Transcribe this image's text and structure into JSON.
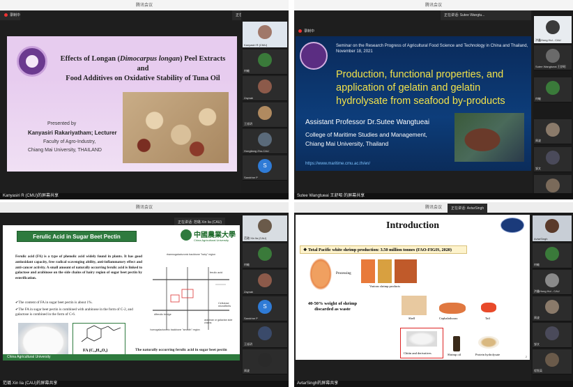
{
  "window_title": "腾讯会议",
  "recording_label": "录制中",
  "q1": {
    "slide": {
      "title": "Effects of Longan (Dimocarpus longan) Peel Extracts and Food Additives on Oxidative Stability of Tuna Oil",
      "title_line1_pre": "Effects of Longan (",
      "title_line1_italic": "Dimocarpus longan",
      "title_line1_post": ") Peel Extracts",
      "title_line2": "and",
      "title_line3": "Food Additives on Oxidative Stability of Tuna Oil",
      "presented_by": "Presented by",
      "presenter": "Kanyasiri  Rakariyatham; Lecturer",
      "affil1": "Faculty of Agro-Industry,",
      "affil2": "Chiang Mai University, THAILAND"
    },
    "speaking": "正在讲话: Kanyasiri R (CMU)",
    "participants": [
      {
        "name": "Kanyasiri R (CMU)"
      },
      {
        "name": "何敏"
      },
      {
        "name": "Zaynab"
      },
      {
        "name": "王娅玥"
      },
      {
        "name": "Hongliang Zhu-CAU"
      },
      {
        "name": "Sandrine P",
        "initial": "S"
      }
    ],
    "footer": "Kanyasiri R (CMU)的屏幕共享"
  },
  "q2": {
    "speaking": "正在讲话: Sutee Wangtu...",
    "slide": {
      "seminar": "Seminar on the Research Progress of Agricultural Food Science and Technology in China and Thailand, November 18, 2021",
      "title": "Production, functional properties, and application of gelatin and gelatin hydrolysate from seafood by-products",
      "presenter": "Assistant Professor Dr.Sutee Wangtueai",
      "affil1": "College of Maritime Studies and Management,",
      "affil2": "Chiang Mai University, Thailand",
      "url": "https://www.maritime.cmu.ac.th/en/"
    },
    "participants": [
      {
        "name": "洪鑫Hong Hui - CAU"
      },
      {
        "name": "Sutee Wangtueai 王舒昭"
      },
      {
        "name": "何敏"
      },
      {
        "name": "周波"
      },
      {
        "name": "邹文"
      },
      {
        "name": "李晓茜"
      }
    ],
    "footer": "Sutee Wangtueai 王舒昭 的屏幕共享"
  },
  "q3": {
    "speaking": "正在讲话: 范璐 Xin lia (CAU)",
    "slide": {
      "title": "Ferulic Acid in Sugar Beet Pectin",
      "logo_cn": "中國農業大學",
      "logo_en": "China Agricultural University",
      "para": "Ferulic acid (FA) is a type of phenolic acid widely found in plants. It has good antioxidant capacity, free radical scavenging ability, anti-inflammatory effect and anti-cancer activity. A small amount of naturally occurring ferulic acid is linked to galactose and arabinose on the side chains of hairy region of sugar beet pectin by esterification.",
      "bullet1": "The content of FA in sugar beet pectin is about 1%.",
      "bullet2": "The FA in sugar beet pectin is combined with arabinose in the form of C-2, and galactose is combined in the form of C-6.",
      "diagram_top": "rhamnogalacturonic backbone \"hairy\" region",
      "ferulic": "ferulic acid",
      "diferulic": "diferulic bridge",
      "cellulose": "Cellulose microfibrils",
      "arabinan": "arabinan or galactan side chains",
      "homogal": "homogalacturonic backbone \"smooth\" region",
      "formula": "FA (C₁₀H₁₀O₄)",
      "caption": "The naturally occurring ferulic acid in sugar beet pectin",
      "footer_bar": "China Agricultural University"
    },
    "participants": [
      {
        "name": "范璐 Xin lia (CAU)"
      },
      {
        "name": "何敏"
      },
      {
        "name": "Zaynab"
      },
      {
        "name": "Sandrine P",
        "initial": "S"
      },
      {
        "name": "王娅玥"
      },
      {
        "name": "周波"
      },
      {
        "name": "邹文"
      }
    ],
    "footer": "范璐 Xin lia (CAU)的屏幕共享"
  },
  "q4": {
    "speaking": "正在讲话: AvtarSingh",
    "slide": {
      "title": "Introduction",
      "production": "Total Pacific white shrimp production: 3.50 million tonnes (FAO-FIGIS, 2020)",
      "processing": "Processing",
      "products": "Various shrimp products",
      "waste": "40-50% weight of shrimp discarded as waste",
      "shell": "Shell",
      "ceph": "Cephalothorax",
      "tail": "Tail",
      "chitin": "Chitin and derivatives",
      "oil": "Shrimp oil",
      "protein": "Protein hydrolysate",
      "page": "2"
    },
    "participants": [
      {
        "name": "AvtarSingh"
      },
      {
        "name": "何敏"
      },
      {
        "name": "洪鑫Hong Hui - CAU"
      },
      {
        "name": "周波"
      },
      {
        "name": "邹文"
      },
      {
        "name": "程智英"
      }
    ],
    "footer": "AvtarSingh的屏幕共享"
  }
}
